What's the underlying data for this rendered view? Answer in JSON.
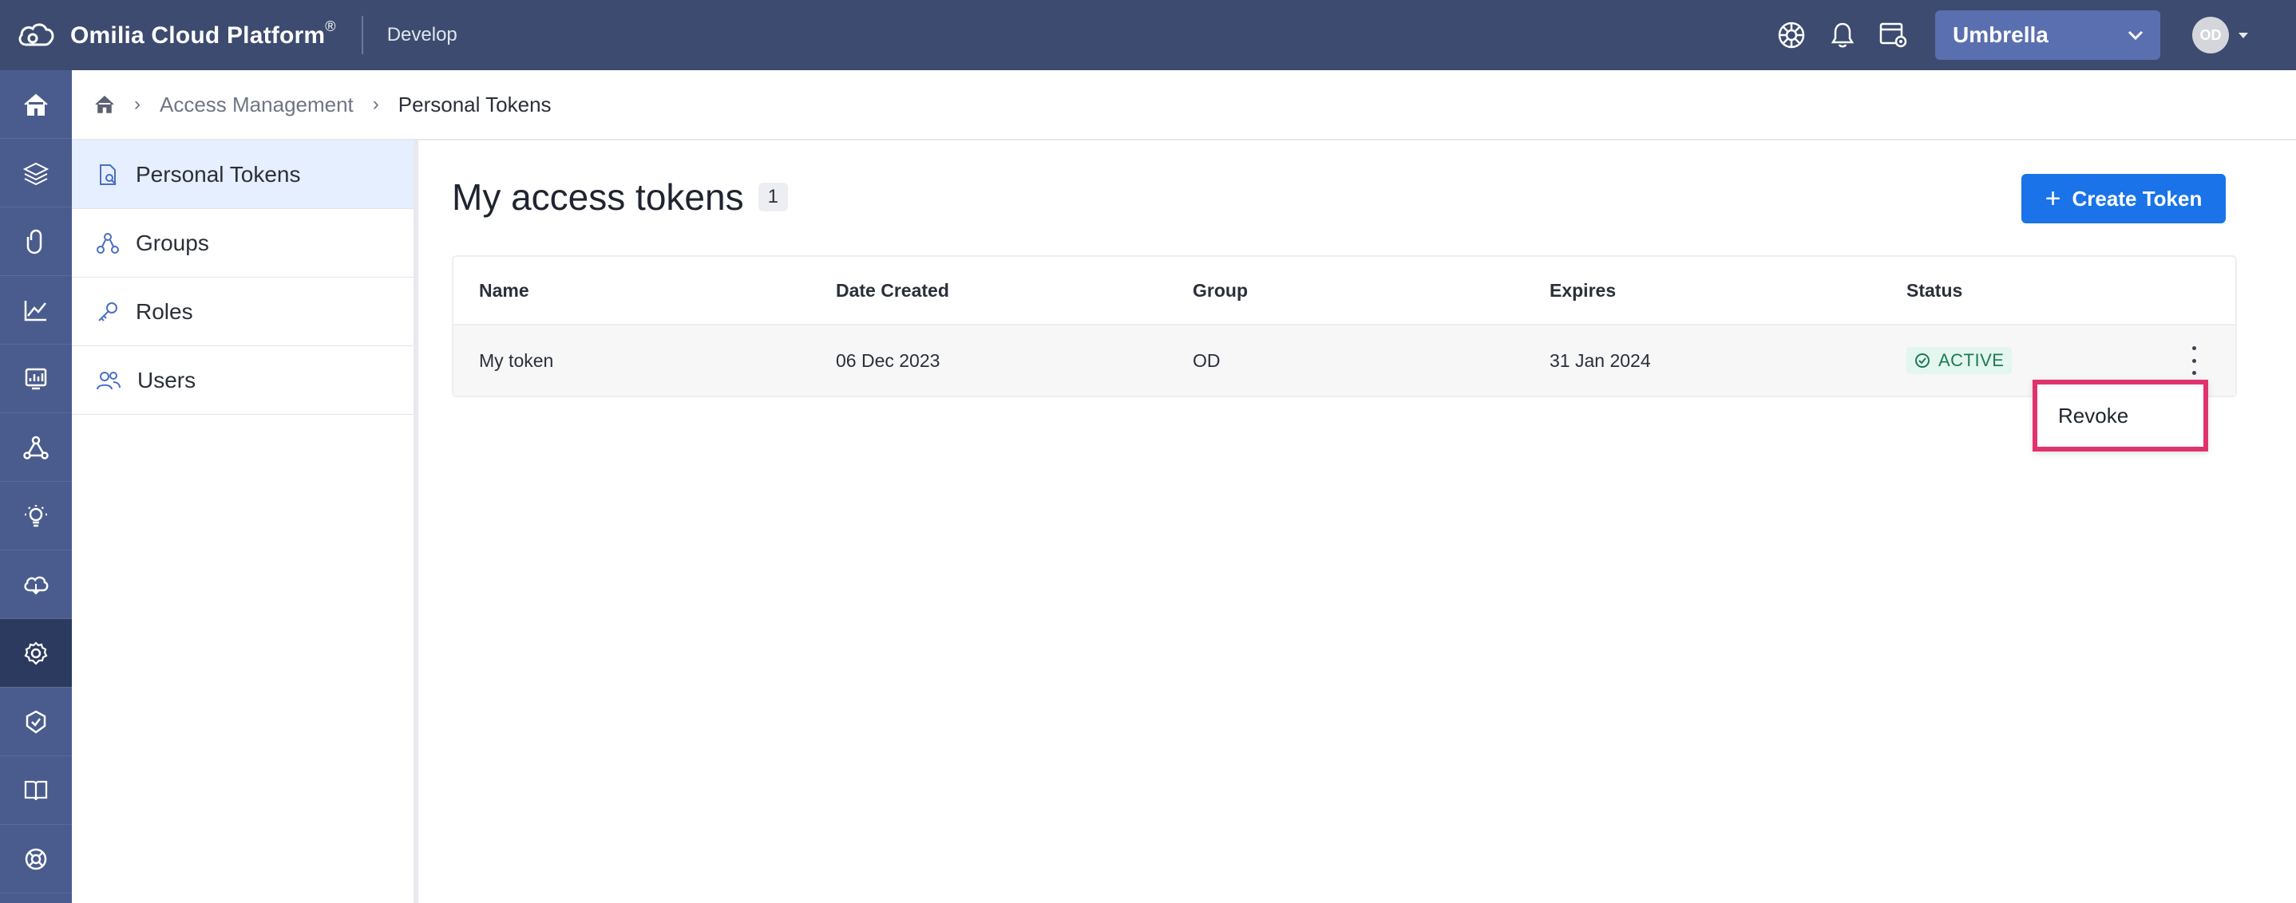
{
  "app": {
    "name": "Omilia Cloud Platform",
    "registered_mark": "®",
    "environment": "Develop"
  },
  "topbar": {
    "org_selected": "Umbrella",
    "avatar_initials": "OD"
  },
  "rail": {
    "icons": [
      "home-icon",
      "layers-icon",
      "clip-icon",
      "chart-icon",
      "monitor-icon",
      "network-icon",
      "bulb-icon",
      "cloud-icon",
      "settings-icon",
      "shield-gear-icon",
      "book-icon",
      "lifebuoy-icon"
    ],
    "active_index": 8
  },
  "breadcrumb": {
    "items": [
      "Access Management",
      "Personal Tokens"
    ]
  },
  "subnav": {
    "items": [
      {
        "label": "Personal Tokens",
        "active": true
      },
      {
        "label": "Groups",
        "active": false
      },
      {
        "label": "Roles",
        "active": false
      },
      {
        "label": "Users",
        "active": false
      }
    ]
  },
  "main": {
    "title": "My access tokens",
    "count": "1",
    "create_label": "Create Token"
  },
  "table": {
    "columns": [
      "Name",
      "Date Created",
      "Group",
      "Expires",
      "Status"
    ],
    "rows": [
      {
        "name": "My token",
        "date_created": "06 Dec 2023",
        "group": "OD",
        "expires": "31 Jan 2024",
        "status": "ACTIVE"
      }
    ]
  },
  "row_menu": {
    "items": [
      "Revoke"
    ]
  },
  "colors": {
    "topbar": "#3c4b6f",
    "rail": "#4a5c8d",
    "accent": "#1a73e8",
    "highlight": "#e0336e",
    "active_status": "#1e7a55"
  }
}
